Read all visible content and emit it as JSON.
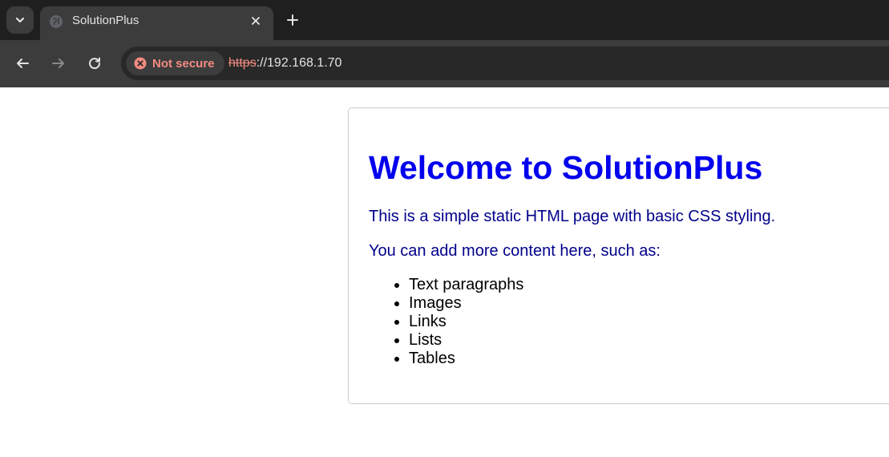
{
  "browser": {
    "tab": {
      "title": "SolutionPlus",
      "favicon": "globe-icon"
    },
    "toolbar": {
      "back_icon": "back-arrow-icon",
      "forward_icon": "forward-arrow-icon",
      "reload_icon": "reload-icon"
    },
    "omnibox": {
      "security_label": "Not secure",
      "security_icon": "warning-circle-icon",
      "url_scheme": "https",
      "url_rest": "://192.168.1.70"
    }
  },
  "page": {
    "heading": "Welcome to SolutionPlus",
    "paragraphs": [
      "This is a simple static HTML page with basic CSS styling.",
      "You can add more content here, such as:"
    ],
    "list_items": [
      "Text paragraphs",
      "Images",
      "Links",
      "Lists",
      "Tables"
    ]
  },
  "colors": {
    "heading": "#0000ee",
    "paragraph": "#00008b",
    "not_secure": "#f28b82",
    "tabstrip": "#1f1f1f",
    "toolbar": "#3c3c3c"
  }
}
